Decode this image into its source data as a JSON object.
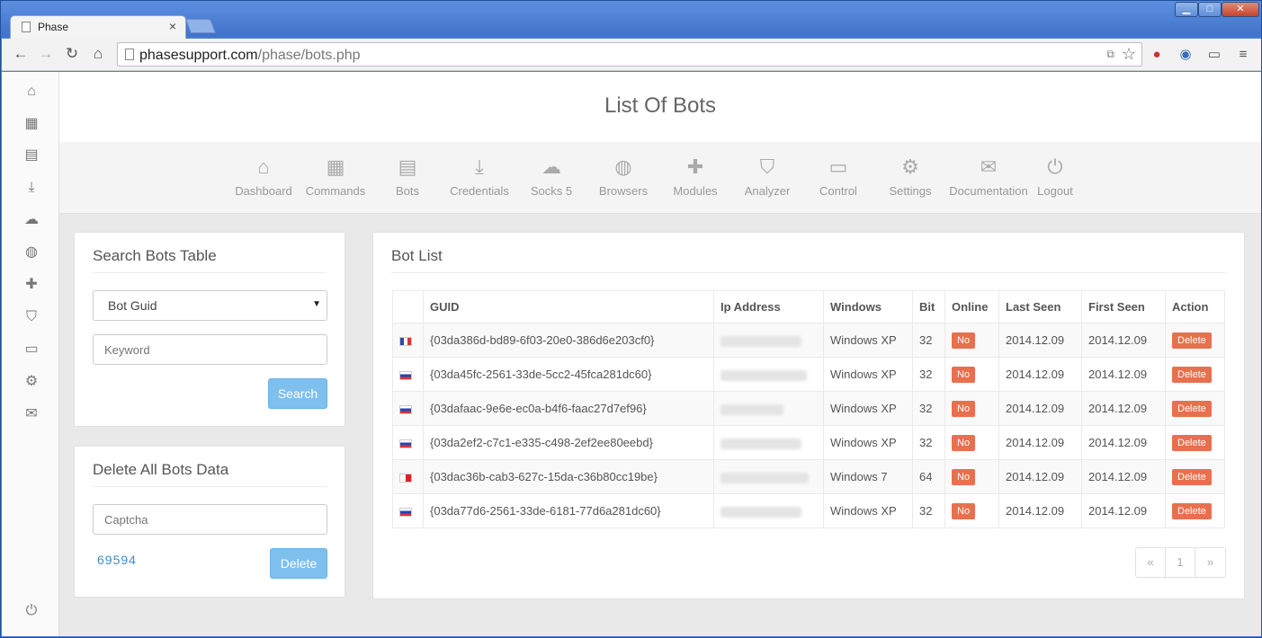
{
  "browser": {
    "tab_title": "Phase",
    "tab_close": "×",
    "url_host": "phasesupport.com",
    "url_path": "/phase/bots.php",
    "controls": {
      "min": "▁",
      "max": "□",
      "close": "✕"
    }
  },
  "page_title": "List Of Bots",
  "nav": [
    {
      "label": "Dashboard",
      "icon": "home-icon"
    },
    {
      "label": "Commands",
      "icon": "calendar-icon"
    },
    {
      "label": "Bots",
      "icon": "table-icon"
    },
    {
      "label": "Credentials",
      "icon": "download-icon"
    },
    {
      "label": "Socks 5",
      "icon": "cloud-icon"
    },
    {
      "label": "Browsers",
      "icon": "globe-icon"
    },
    {
      "label": "Modules",
      "icon": "puzzle-icon"
    },
    {
      "label": "Analyzer",
      "icon": "shield-icon"
    },
    {
      "label": "Control",
      "icon": "monitor-icon"
    },
    {
      "label": "Settings",
      "icon": "gears-icon"
    },
    {
      "label": "Documentation",
      "icon": "comments-icon"
    },
    {
      "label": "Logout",
      "icon": "power-icon"
    }
  ],
  "search_panel": {
    "title": "Search Bots Table",
    "select_value": "Bot Guid",
    "keyword_placeholder": "Keyword",
    "search_button": "Search"
  },
  "delete_panel": {
    "title": "Delete All Bots Data",
    "captcha_placeholder": "Captcha",
    "captcha_code": "69594",
    "delete_button": "Delete"
  },
  "bot_list": {
    "title": "Bot List",
    "columns": [
      "",
      "GUID",
      "Ip Address",
      "Windows",
      "Bit",
      "Online",
      "Last Seen",
      "First Seen",
      "Action"
    ],
    "rows": [
      {
        "flag": "fr",
        "guid": "{03da386d-bd89-6f03-20e0-386d6e203cf0}",
        "windows": "Windows XP",
        "bit": "32",
        "online": "No",
        "last_seen": "2014.12.09",
        "first_seen": "2014.12.09",
        "action": "Delete"
      },
      {
        "flag": "ru",
        "guid": "{03da45fc-2561-33de-5cc2-45fca281dc60}",
        "windows": "Windows XP",
        "bit": "32",
        "online": "No",
        "last_seen": "2014.12.09",
        "first_seen": "2014.12.09",
        "action": "Delete"
      },
      {
        "flag": "ru",
        "guid": "{03dafaac-9e6e-ec0a-b4f6-faac27d7ef96}",
        "windows": "Windows XP",
        "bit": "32",
        "online": "No",
        "last_seen": "2014.12.09",
        "first_seen": "2014.12.09",
        "action": "Delete"
      },
      {
        "flag": "ru",
        "guid": "{03da2ef2-c7c1-e335-c498-2ef2ee80eebd}",
        "windows": "Windows XP",
        "bit": "32",
        "online": "No",
        "last_seen": "2014.12.09",
        "first_seen": "2014.12.09",
        "action": "Delete"
      },
      {
        "flag": "mt",
        "guid": "{03dac36b-cab3-627c-15da-c36b80cc19be}",
        "windows": "Windows 7",
        "bit": "64",
        "online": "No",
        "last_seen": "2014.12.09",
        "first_seen": "2014.12.09",
        "action": "Delete"
      },
      {
        "flag": "ru",
        "guid": "{03da77d6-2561-33de-6181-77d6a281dc60}",
        "windows": "Windows XP",
        "bit": "32",
        "online": "No",
        "last_seen": "2014.12.09",
        "first_seen": "2014.12.09",
        "action": "Delete"
      }
    ],
    "pagination": [
      "«",
      "1",
      "»"
    ]
  },
  "colors": {
    "accent_blue": "#7fbfee",
    "danger": "#e8704f"
  }
}
